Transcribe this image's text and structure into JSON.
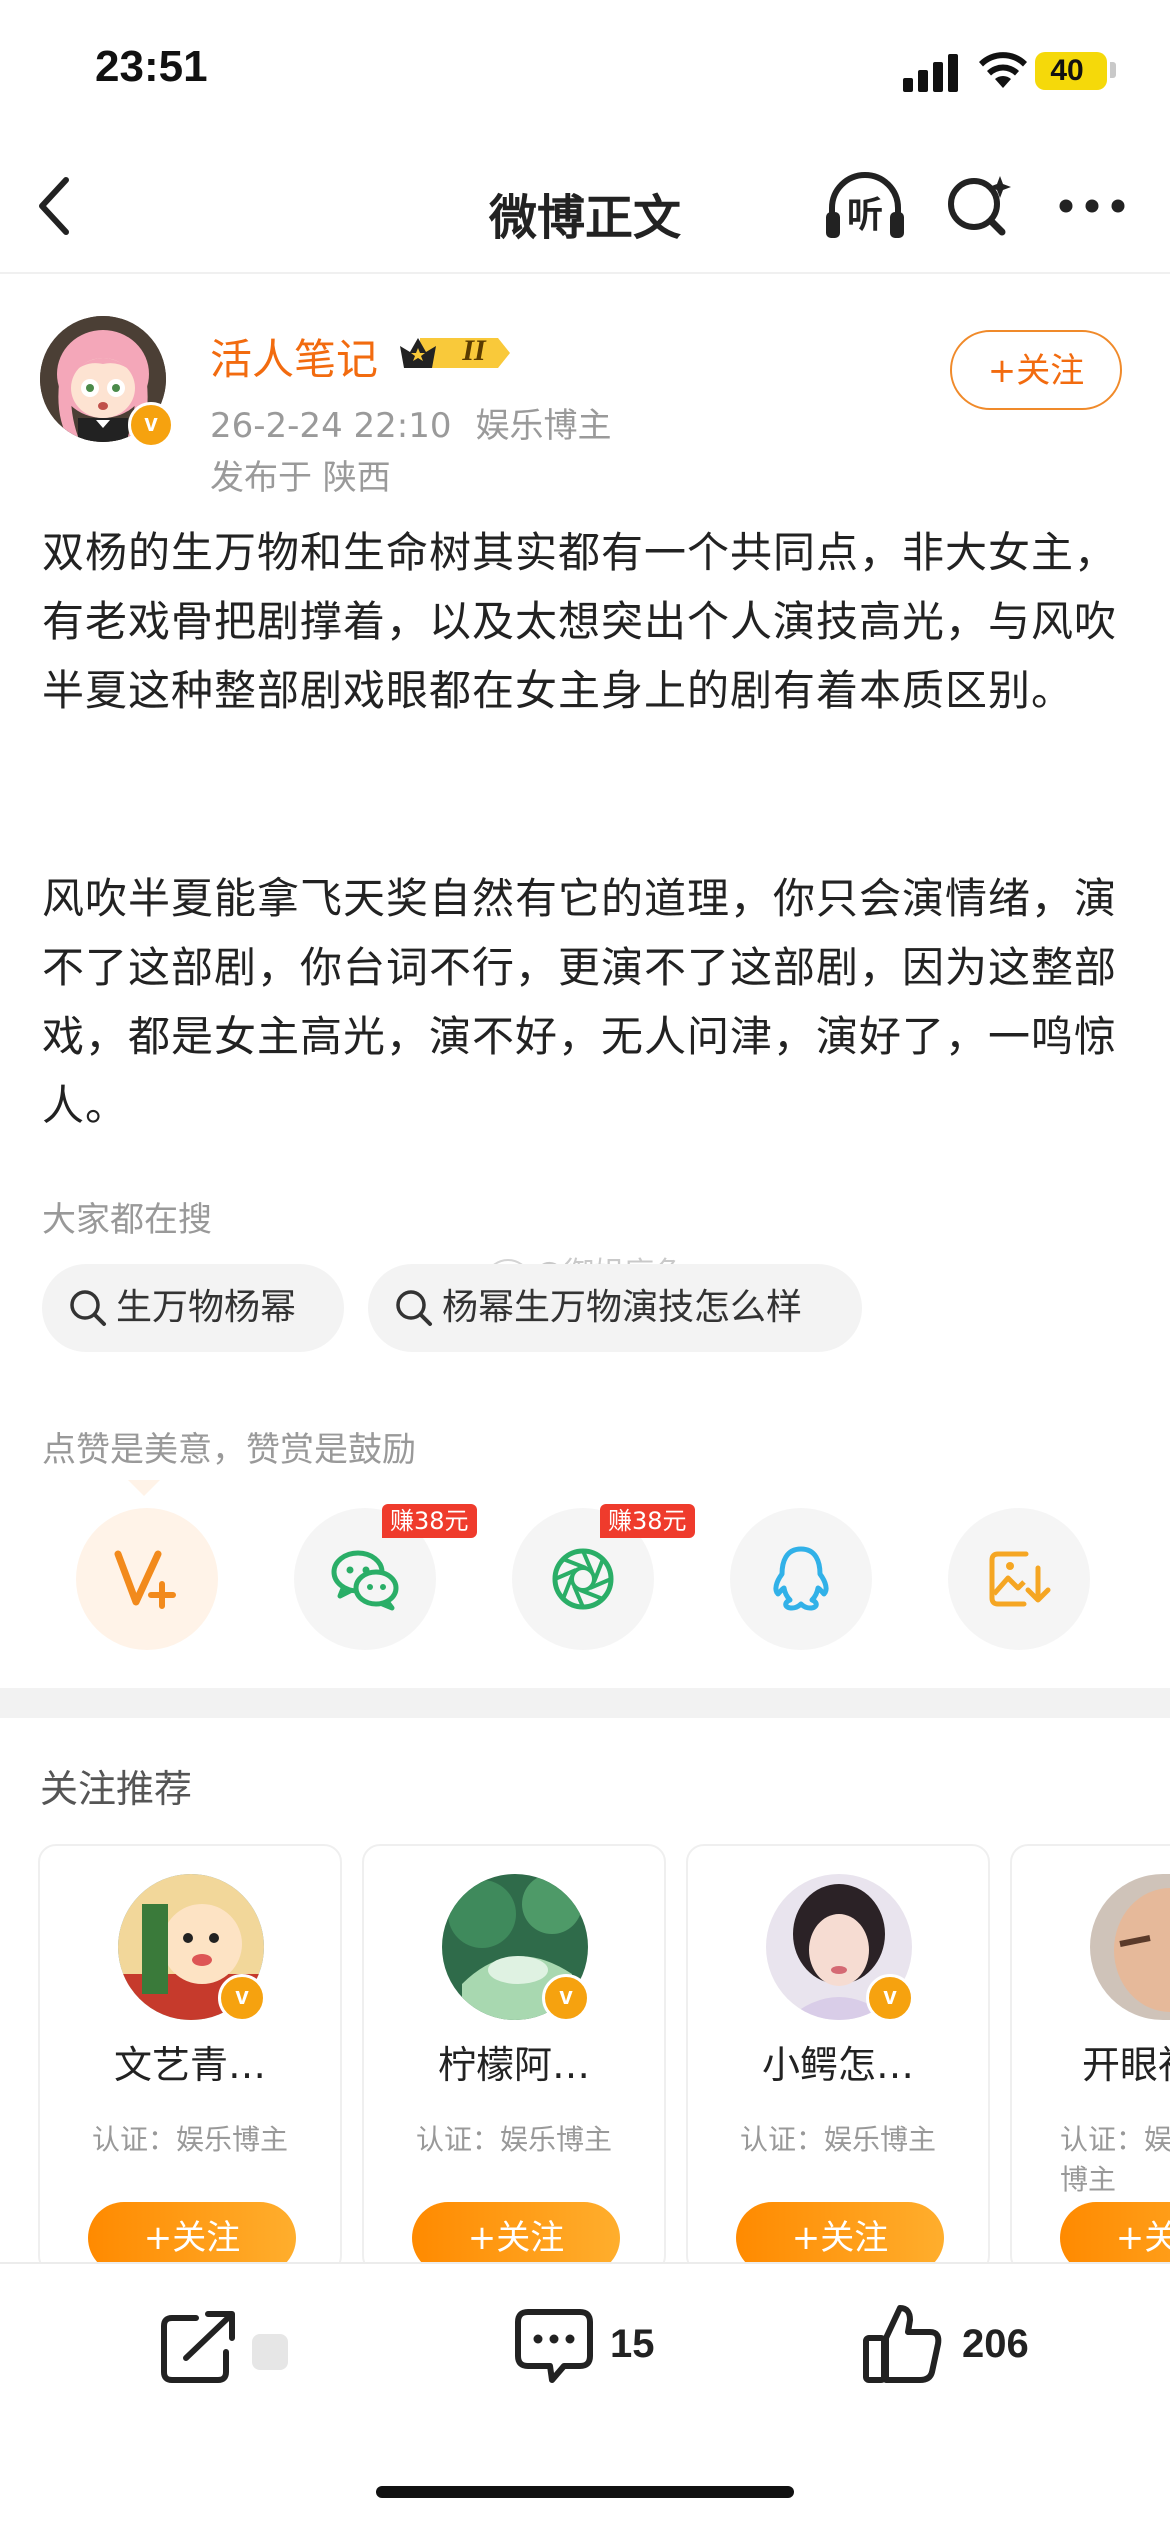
{
  "status_bar": {
    "time": "23:51",
    "battery": "40"
  },
  "nav": {
    "title": "微博正文",
    "listen_label": "听"
  },
  "author": {
    "name": "活人笔记",
    "level": "II",
    "timestamp": "26-2-24 22:10",
    "tag": "娱乐博主",
    "location": "发布于 陕西",
    "follow_label": "+关注",
    "verified_mark": "v"
  },
  "post": {
    "paragraphs": [
      "双杨的生万物和生命树其实都有一个共同点，非大女主，有老戏骨把剧撑着，以及太想突出个人演技高光，与风吹半夏这种整部剧戏眼都在女主身上的剧有着本质区别。",
      "风吹半夏能拿飞天奖自然有它的道理，你只会演情绪，演不了这部剧，你台词不行，更演不了这部剧，因为这整部戏，都是女主高光，演不好，无人问津，演好了，一鸣惊人。"
    ]
  },
  "search": {
    "label": "大家都在搜",
    "chips": [
      "生万物杨幂",
      "杨幂生万物演技怎么样"
    ],
    "watermark": "@御姐底色"
  },
  "reward": {
    "label": "点赞是美意，赞赏是鼓励",
    "earn_tag": "赚38元"
  },
  "recommend": {
    "title": "关注推荐",
    "follow_label": "+关注",
    "cards": [
      {
        "name": "文艺青…",
        "cert": "认证：娱乐博主"
      },
      {
        "name": "柠檬阿…",
        "cert": "认证：娱乐博主"
      },
      {
        "name": "小鳄怎…",
        "cert": "认证：娱乐博主"
      },
      {
        "name": "开眼社",
        "cert": "认证：娱乐博主"
      }
    ]
  },
  "bottom_bar": {
    "comments": "15",
    "likes": "206"
  },
  "colors": {
    "accent": "#f26b0f",
    "follow_gradient": "#ff8a00",
    "earn_tag": "#ef3b2c"
  }
}
